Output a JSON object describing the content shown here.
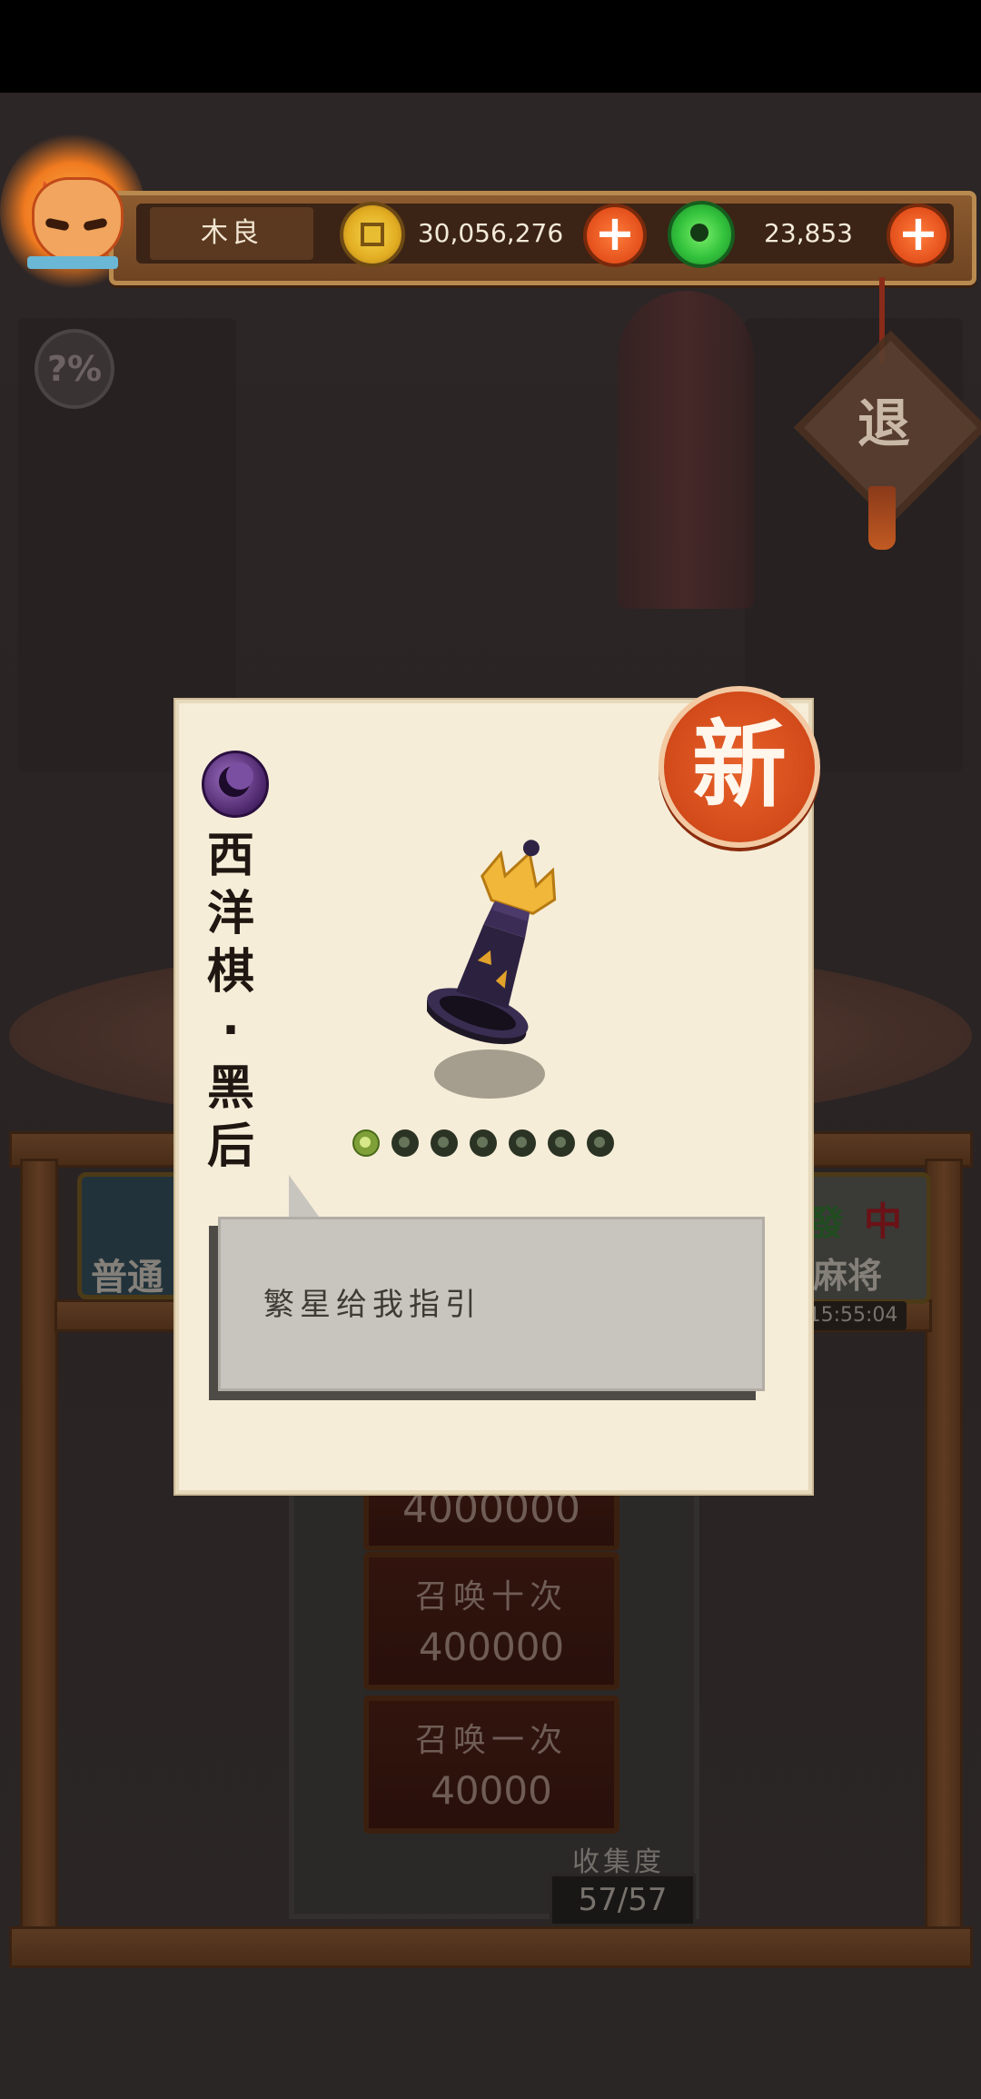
{
  "player": {
    "name": "木良",
    "avatar": "fox-mask-avatar"
  },
  "currency": {
    "coins": {
      "icon": "copper-coin-icon",
      "amount": "30,056,276"
    },
    "jade": {
      "icon": "jade-disc-icon",
      "amount": "23,853"
    }
  },
  "buttons": {
    "help": "?%",
    "quit": "退"
  },
  "background": {
    "left_tab": "普通",
    "right_tab": "麻将",
    "right_tiles": [
      "發",
      "中"
    ],
    "timer": "15:55:04",
    "summon_top_price": "4000000",
    "summon_ten_label": "召唤十次",
    "summon_ten_price": "400000",
    "summon_one_label": "召唤一次",
    "summon_one_price": "40000",
    "collection_label": "收集度",
    "collection_value": "57/57"
  },
  "card": {
    "badge": "新",
    "rarity_icon": "purple-moon-orb-icon",
    "title_chars": [
      "西",
      "洋",
      "棋",
      "·",
      "黑",
      "后"
    ],
    "item_icon": "black-queen-chess-piece-icon",
    "level_dots_total": 7,
    "level_dots_active": 1,
    "quote": "繁星给我指引"
  },
  "colors": {
    "card_bg": "#f6edd8",
    "badge": "#d24a1a",
    "topbar": "#8c5b2f"
  }
}
